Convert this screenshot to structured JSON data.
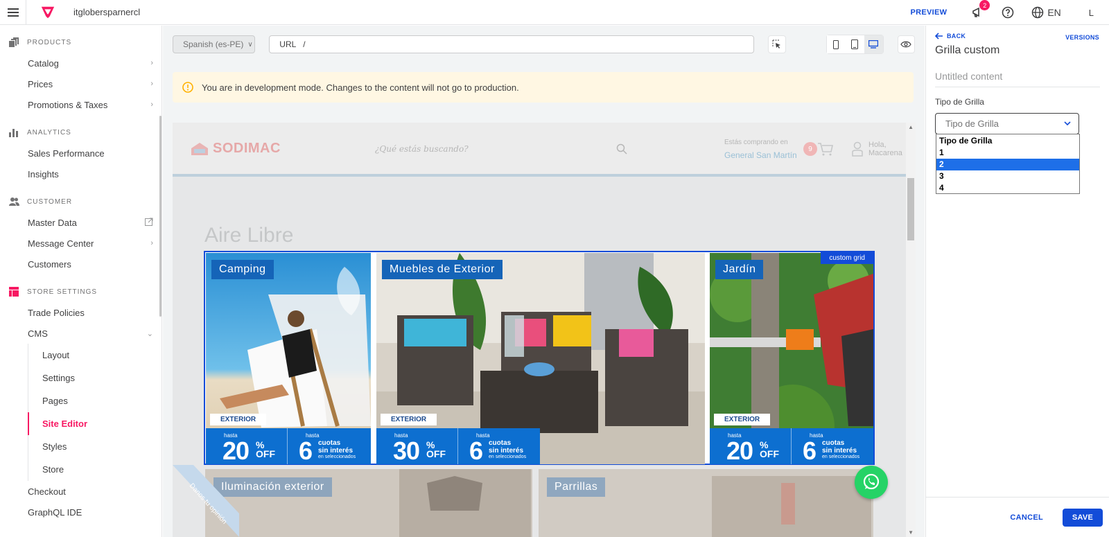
{
  "topbar": {
    "account": "itglobers partnercl",
    "account_display": "itglobersparnercl",
    "preview_label": "PREVIEW",
    "notification_count": "2",
    "language": "EN",
    "user_initial": "L"
  },
  "sidebar": {
    "sections": [
      {
        "label": "PRODUCTS",
        "icon": "products-icon",
        "items": [
          {
            "label": "Catalog",
            "chevron": true
          },
          {
            "label": "Prices",
            "chevron": true
          },
          {
            "label": "Promotions & Taxes",
            "chevron": true
          }
        ]
      },
      {
        "label": "ANALYTICS",
        "icon": "analytics-icon",
        "items": [
          {
            "label": "Sales Performance"
          },
          {
            "label": "Insights"
          }
        ]
      },
      {
        "label": "CUSTOMER",
        "icon": "customer-icon",
        "items": [
          {
            "label": "Master Data",
            "external": true
          },
          {
            "label": "Message Center",
            "chevron": true
          },
          {
            "label": "Customers"
          }
        ]
      },
      {
        "label": "STORE SETTINGS",
        "icon": "store-settings-icon",
        "items": [
          {
            "label": "Trade Policies"
          },
          {
            "label": "CMS",
            "expanded": true
          }
        ]
      }
    ],
    "cms_sub": [
      "Layout",
      "Settings",
      "Pages",
      "Site Editor",
      "Styles",
      "Store"
    ],
    "active_sub": "Site Editor",
    "after": [
      "Checkout",
      "GraphQL IDE"
    ]
  },
  "toolbar": {
    "locale": "Spanish (es-PE)",
    "url_label": "URL",
    "url_value": "/"
  },
  "dev_banner": "You are in development mode. Changes to the content will not go to production.",
  "site": {
    "brand": "SODIMAC",
    "search_placeholder": "¿Qué estás buscando?",
    "store_line1": "Estás comprando en",
    "store_city": "General San Martín",
    "cart_count": "9",
    "greeting_1": "Hola,",
    "greeting_2": "Macarena",
    "section_title": "Aire Libre",
    "custom_grid_label": "custom grid",
    "tiles": [
      {
        "title": "Camping",
        "tag": "EXTERIOR",
        "hasta": "hasta",
        "discount": "20",
        "off": "OFF",
        "cuotas_num": "6",
        "cuotas": "cuotas",
        "sin_interes": "sin interés",
        "seleccionados": "en seleccionados"
      },
      {
        "title": "Muebles de Exterior",
        "tag": "EXTERIOR",
        "hasta": "hasta",
        "discount": "30",
        "off": "OFF",
        "cuotas_num": "6",
        "cuotas": "cuotas",
        "sin_interes": "sin interés",
        "seleccionados": "en seleccionados"
      },
      {
        "title": "Jardín",
        "tag": "EXTERIOR",
        "hasta": "hasta",
        "discount": "20",
        "off": "OFF",
        "cuotas_num": "6",
        "cuotas": "cuotas",
        "sin_interes": "sin interés",
        "seleccionados": "en seleccionados"
      }
    ],
    "row2": [
      "Iluminación exterior",
      "Parrillas"
    ],
    "feedback_ribbon": "Danos tu opinión"
  },
  "panel": {
    "back_label": "BACK",
    "versions_label": "VERSIONS",
    "title": "Grilla custom",
    "content_name_placeholder": "Untitled content",
    "field_label": "Tipo de Grilla",
    "select_value": "Tipo de Grilla",
    "options": [
      "Tipo de Grilla",
      "1",
      "2",
      "3",
      "4"
    ],
    "highlighted_option": "2",
    "cancel_label": "CANCEL",
    "save_label": "SAVE"
  },
  "colors": {
    "vtex_pink": "#f71963",
    "action_blue": "#134cd8",
    "warning_bg": "#fff7e3"
  }
}
